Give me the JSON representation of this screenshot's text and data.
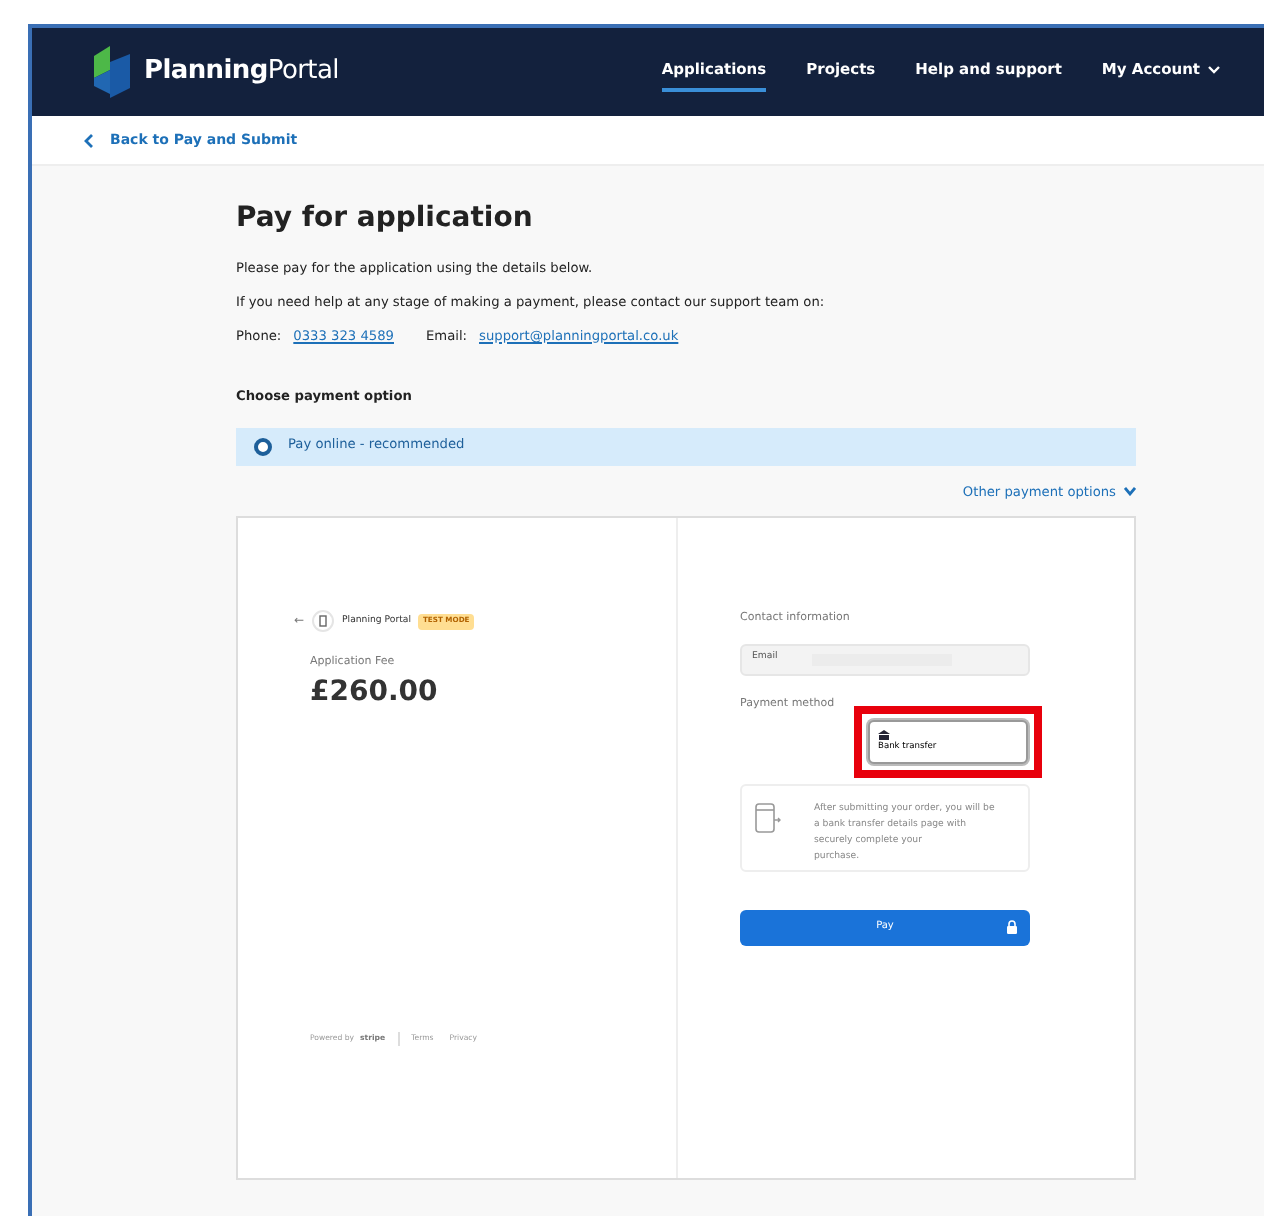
{
  "header": {
    "logo": {
      "bold": "Planning",
      "light": "Portal"
    },
    "nav": [
      {
        "label": "Applications",
        "selected": true
      },
      {
        "label": "Projects",
        "selected": false
      },
      {
        "label": "Help and support",
        "selected": false
      },
      {
        "label": "My Account",
        "selected": false,
        "dropdown": true
      }
    ]
  },
  "back_link": "Back to Pay and Submit",
  "title": "Pay for application",
  "intro": [
    "Please pay for the application using the details below.",
    "If you need help at any stage of making a payment, please contact our support team on:"
  ],
  "contact": {
    "phone_label": "Phone:",
    "phone": "0333 323 4589",
    "email_label": "Email:",
    "email": "support@planningportal.co.uk"
  },
  "payment_option": {
    "heading": "Choose payment option",
    "options": [
      {
        "label": "Pay online - recommended",
        "selected": true
      }
    ],
    "other_link": "Other payment options"
  },
  "checkout": {
    "back": "←",
    "merchant": "Planning Portal",
    "badge": "TEST MODE",
    "fee_label": "Application Fee",
    "amount": "£260.00",
    "footer": {
      "powered": "Powered by",
      "brand": "stripe",
      "links": [
        "Terms",
        "Privacy"
      ]
    },
    "contact_heading": "Contact information",
    "email_placeholder": "Email",
    "method_heading": "Payment method",
    "methods": [
      {
        "label": "Bank transfer",
        "selected": true,
        "highlighted": true
      }
    ],
    "info_lines": [
      "After submitting your order, you will be",
      "a bank transfer details page with",
      "securely complete your",
      "purchase."
    ],
    "pay_button": "Pay"
  }
}
